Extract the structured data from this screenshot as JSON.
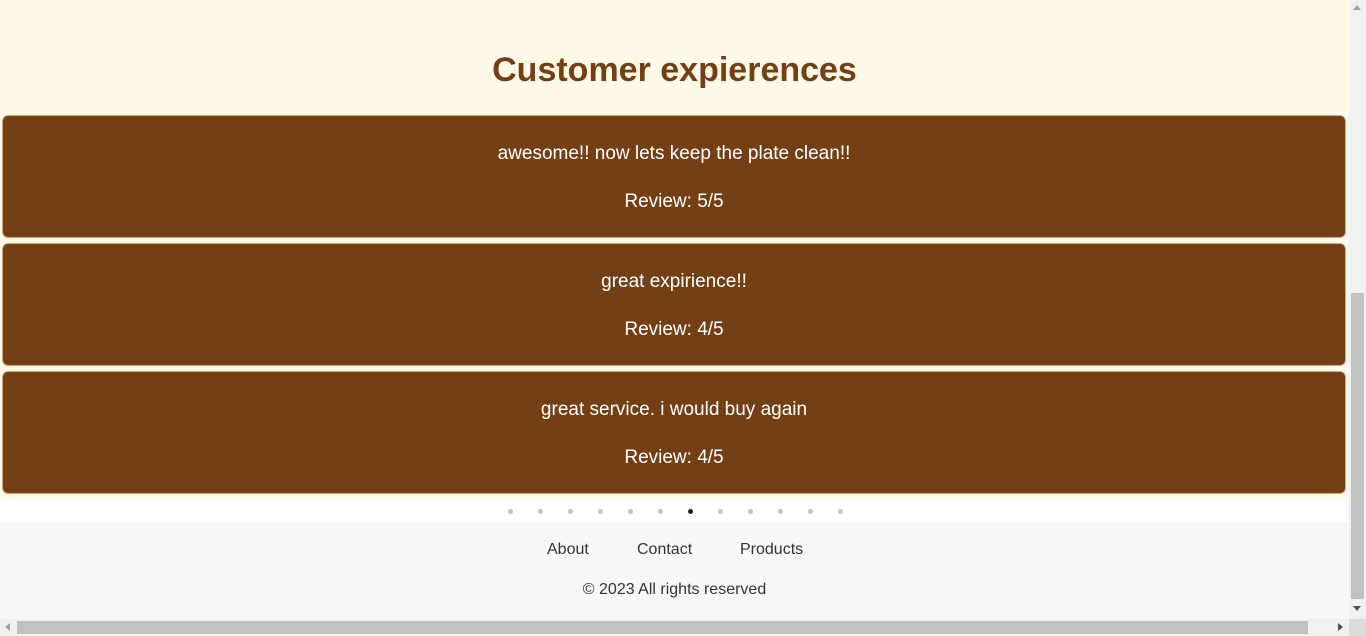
{
  "section": {
    "title": "Customer expierences"
  },
  "reviews": [
    {
      "comment": "awesome!! now lets keep the plate clean!!",
      "rating": "Review: 5/5"
    },
    {
      "comment": "great expirience!!",
      "rating": "Review: 4/5"
    },
    {
      "comment": "great service. i would buy again",
      "rating": "Review: 4/5"
    }
  ],
  "carousel": {
    "total_pages": 12,
    "active_index": 6
  },
  "footer": {
    "links": [
      "About",
      "Contact",
      "Products"
    ],
    "copyright": "© 2023 All rights reserved"
  },
  "colors": {
    "section_bg": "#fffae8",
    "brand_brown": "#733f14",
    "footer_bg": "#f8f8f8"
  }
}
